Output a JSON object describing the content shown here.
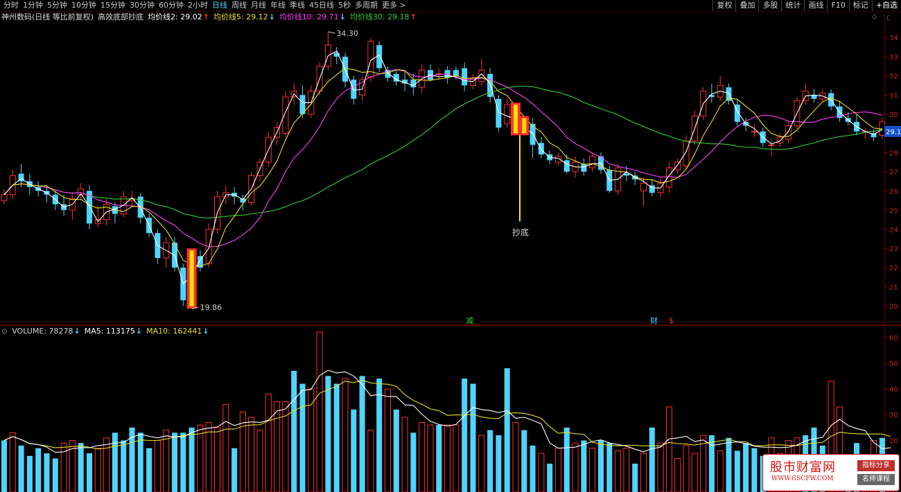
{
  "toolbar": {
    "tabs": [
      "分时",
      "1分钟",
      "5分钟",
      "10分钟",
      "15分钟",
      "30分钟",
      "60分钟",
      "2小时",
      "日线",
      "周线",
      "月线",
      "年线",
      "季线",
      "45日线",
      "5秒",
      "多周期",
      "更多 >"
    ],
    "active_tab": "日线",
    "right_tools": [
      "复权",
      "叠加",
      "多股",
      "统计",
      "画线",
      "F10",
      "标记"
    ],
    "select_label": "+自选"
  },
  "price_legend": {
    "title": "神州数码(日线 等比前复权)",
    "indicator": "高效底部抄底",
    "ma2": "均价线2: 29.02",
    "ma2_dir": "↑",
    "ma5": "均价线5: 29.12",
    "ma5_dir": "↓",
    "ma10": "均价线10: 29.71",
    "ma10_dir": "↓",
    "ma30": "均价线30: 29.18",
    "ma30_dir": "↑"
  },
  "volume_legend": {
    "volume": "VOLUME: 78278",
    "volume_dir": "↓",
    "ma5": "MA5: 113175",
    "ma5_dir": "↓",
    "ma10": "MA10: 162441",
    "ma10_dir": "↓"
  },
  "colors": {
    "up": "#ff3030",
    "down": "#4fd4ff",
    "ma2": "#ffffff",
    "ma5": "#e8e020",
    "ma10": "#ff40ff",
    "ma30": "#30d030",
    "signal": "#ffe000"
  },
  "watermark": {
    "title": "股市财富网",
    "url": "WWW.GSCFW.COM",
    "badge1": "指标分享",
    "badge2": "名师课程"
  },
  "chart_data": [
    {
      "type": "candlestick",
      "y_axis_labels": [
        "34",
        "33",
        "32",
        "31",
        "30",
        "29",
        "28",
        "27",
        "26",
        "25",
        "24",
        "23",
        "22",
        "21",
        "20"
      ],
      "current_price": "29.1",
      "annotations": {
        "high_label": "34.30",
        "low_label": "19.86",
        "signal_label": "抄底"
      },
      "event_markers": [
        {
          "label": "减",
          "color": "#30d030"
        },
        {
          "label": "财",
          "color": "#4fd4ff"
        },
        {
          "label": "$",
          "color": "#ff3030"
        }
      ],
      "ylim": [
        19.5,
        34.8
      ],
      "candles": [
        [
          25.5,
          25.8,
          26.1,
          25.3
        ],
        [
          25.8,
          26.8,
          27.1,
          25.6
        ],
        [
          26.9,
          26.5,
          27.4,
          26.2
        ],
        [
          26.5,
          26.2,
          26.9,
          25.8
        ],
        [
          26.2,
          26.0,
          26.5,
          25.7
        ],
        [
          26.0,
          25.8,
          26.3,
          25.4
        ],
        [
          25.8,
          25.3,
          26.0,
          25.0
        ],
        [
          25.3,
          25.0,
          25.8,
          24.7
        ],
        [
          25.0,
          25.6,
          25.9,
          24.5
        ],
        [
          25.8,
          26.1,
          26.4,
          25.5
        ],
        [
          26.0,
          24.3,
          26.3,
          24.0
        ],
        [
          24.3,
          24.5,
          25.2,
          24.1
        ],
        [
          24.5,
          25.3,
          25.6,
          24.2
        ],
        [
          25.2,
          24.8,
          25.4,
          24.3
        ],
        [
          24.8,
          25.7,
          26.0,
          24.6
        ],
        [
          25.5,
          25.6,
          26.0,
          25.2
        ],
        [
          25.7,
          24.6,
          25.9,
          24.3
        ],
        [
          24.6,
          23.8,
          24.8,
          23.6
        ],
        [
          23.8,
          22.5,
          24.0,
          22.2
        ],
        [
          22.5,
          23.3,
          23.6,
          22.0
        ],
        [
          23.3,
          22.0,
          23.6,
          21.8
        ],
        [
          22.0,
          20.3,
          22.2,
          20.0
        ],
        [
          20.3,
          22.8,
          23.0,
          19.86
        ],
        [
          22.6,
          22.0,
          22.9,
          21.8
        ],
        [
          22.2,
          24.0,
          24.3,
          22.0
        ],
        [
          24.0,
          25.7,
          26.0,
          23.8
        ],
        [
          25.7,
          25.9,
          26.3,
          25.3
        ],
        [
          25.9,
          25.7,
          26.2,
          25.3
        ],
        [
          25.6,
          25.4,
          25.8,
          25.0
        ],
        [
          25.4,
          26.8,
          27.0,
          25.2
        ],
        [
          26.8,
          27.5,
          27.7,
          26.5
        ],
        [
          27.5,
          28.8,
          29.1,
          27.3
        ],
        [
          28.8,
          29.3,
          29.6,
          28.4
        ],
        [
          29.0,
          30.9,
          31.2,
          28.8
        ],
        [
          30.9,
          31.2,
          31.6,
          30.5
        ],
        [
          31.0,
          30.0,
          31.5,
          29.8
        ],
        [
          30.0,
          31.2,
          31.5,
          29.8
        ],
        [
          31.2,
          32.5,
          32.7,
          31.0
        ],
        [
          32.5,
          33.6,
          34.3,
          32.3
        ],
        [
          33.2,
          33.0,
          33.5,
          32.6
        ],
        [
          33.0,
          31.7,
          33.2,
          31.4
        ],
        [
          31.8,
          30.8,
          32.0,
          30.5
        ],
        [
          31.0,
          31.8,
          32.0,
          30.7
        ],
        [
          31.9,
          33.8,
          34.0,
          31.7
        ],
        [
          33.6,
          32.4,
          33.8,
          32.2
        ],
        [
          32.3,
          31.9,
          32.5,
          31.7
        ],
        [
          32.1,
          31.7,
          32.3,
          31.5
        ],
        [
          31.8,
          31.6,
          32.2,
          31.2
        ],
        [
          31.8,
          31.4,
          32.1,
          31.0
        ],
        [
          31.4,
          32.3,
          32.6,
          31.1
        ],
        [
          32.3,
          31.8,
          32.6,
          31.7
        ],
        [
          32.1,
          32.1,
          32.4,
          31.8
        ],
        [
          32.3,
          31.9,
          32.5,
          31.6
        ],
        [
          32.3,
          32.0,
          32.5,
          31.8
        ],
        [
          32.4,
          31.5,
          32.7,
          31.2
        ],
        [
          31.5,
          31.9,
          32.1,
          31.3
        ],
        [
          31.7,
          32.3,
          32.9,
          31.5
        ],
        [
          32.1,
          30.9,
          32.4,
          30.6
        ],
        [
          30.8,
          29.3,
          31.0,
          29.1
        ],
        [
          29.5,
          30.5,
          30.8,
          29.3
        ],
        [
          30.4,
          29.0,
          30.6,
          28.9
        ],
        [
          29.1,
          29.6,
          29.9,
          28.9
        ],
        [
          29.5,
          28.4,
          29.8,
          27.7
        ],
        [
          28.5,
          27.9,
          28.8,
          27.7
        ],
        [
          27.9,
          27.6,
          28.1,
          27.4
        ],
        [
          27.5,
          27.8,
          28.0,
          27.3
        ],
        [
          27.6,
          27.0,
          27.9,
          26.9
        ],
        [
          27.0,
          27.5,
          27.8,
          26.7
        ],
        [
          27.4,
          27.0,
          27.7,
          26.8
        ],
        [
          27.2,
          27.8,
          28.0,
          27.0
        ],
        [
          27.8,
          27.1,
          28.0,
          26.9
        ],
        [
          27.1,
          26.0,
          27.3,
          25.9
        ],
        [
          26.0,
          27.2,
          27.4,
          25.8
        ],
        [
          26.9,
          26.8,
          27.3,
          26.5
        ],
        [
          26.8,
          26.6,
          27.0,
          26.3
        ],
        [
          26.0,
          26.4,
          26.7,
          25.2
        ],
        [
          26.3,
          25.9,
          26.6,
          25.7
        ],
        [
          25.9,
          26.4,
          26.7,
          25.7
        ],
        [
          26.2,
          27.2,
          27.5,
          25.9
        ],
        [
          27.1,
          27.5,
          27.7,
          26.9
        ],
        [
          27.3,
          28.6,
          28.9,
          27.1
        ],
        [
          28.6,
          29.9,
          30.2,
          28.4
        ],
        [
          29.9,
          31.2,
          31.4,
          29.7
        ],
        [
          31.0,
          30.9,
          31.6,
          30.6
        ],
        [
          30.9,
          31.5,
          32.0,
          30.7
        ],
        [
          31.4,
          30.7,
          31.6,
          30.5
        ],
        [
          30.5,
          29.6,
          30.8,
          29.4
        ],
        [
          29.6,
          29.4,
          29.8,
          29.1
        ],
        [
          29.1,
          29.1,
          29.5,
          28.8
        ],
        [
          29.1,
          28.5,
          29.3,
          28.3
        ],
        [
          28.4,
          28.4,
          28.7,
          27.8
        ],
        [
          28.5,
          28.8,
          29.0,
          28.3
        ],
        [
          28.7,
          29.4,
          29.6,
          28.5
        ],
        [
          29.4,
          30.7,
          30.9,
          29.2
        ],
        [
          30.7,
          31.2,
          31.6,
          30.5
        ],
        [
          31.0,
          30.8,
          31.3,
          30.6
        ],
        [
          30.8,
          31.1,
          31.3,
          30.6
        ],
        [
          31.1,
          30.4,
          31.3,
          30.2
        ],
        [
          30.4,
          29.8,
          30.7,
          29.6
        ],
        [
          29.8,
          29.6,
          30.1,
          29.4
        ],
        [
          29.6,
          29.1,
          30.0,
          28.9
        ],
        [
          29.1,
          29.1,
          29.3,
          28.7
        ],
        [
          29.0,
          28.8,
          29.2,
          28.6
        ],
        [
          28.9,
          29.6,
          29.8,
          28.7
        ]
      ],
      "signal_candles": [
        22,
        60,
        61
      ]
    },
    {
      "type": "bar",
      "y_axis_labels": [
        "60",
        "50",
        "40",
        "30",
        "20"
      ],
      "ylim": [
        0,
        62
      ],
      "volumes": [
        20,
        23,
        18,
        14,
        17,
        15,
        13,
        19,
        20,
        19,
        15,
        17,
        21,
        23,
        20,
        25,
        23,
        17,
        20,
        24,
        23,
        23,
        25,
        26,
        27,
        25,
        34,
        17,
        31,
        29,
        24,
        38,
        35,
        35,
        47,
        42,
        40,
        62,
        45,
        42,
        44,
        32,
        45,
        24,
        44,
        40,
        32,
        29,
        23,
        27,
        26,
        26,
        26,
        26,
        44,
        42,
        22,
        24,
        22,
        48,
        27,
        24,
        18,
        15,
        11,
        17,
        25,
        19,
        20,
        17,
        20,
        19,
        16,
        17,
        11,
        15,
        25,
        19,
        33,
        13,
        18,
        15,
        22,
        22,
        16,
        21,
        16,
        19,
        17,
        14,
        21,
        15,
        20,
        21,
        22,
        25,
        18,
        43,
        33,
        10,
        19,
        14,
        20,
        21,
        12
      ],
      "vol_up": [
        false,
        true,
        false,
        false,
        false,
        false,
        false,
        true,
        true,
        false,
        false,
        true,
        true,
        false,
        false,
        false,
        false,
        false,
        true,
        true,
        false,
        false,
        false,
        true,
        true,
        true,
        true,
        false,
        true,
        true,
        true,
        true,
        true,
        true,
        false,
        false,
        true,
        true,
        false,
        false,
        true,
        false,
        false,
        true,
        false,
        true,
        false,
        true,
        false,
        true,
        true,
        false,
        true,
        true,
        false,
        false,
        true,
        false,
        false,
        false,
        true,
        false,
        false,
        true,
        false,
        true,
        false,
        true,
        false,
        true,
        false,
        false,
        true,
        true,
        false,
        true,
        false,
        true,
        true,
        true,
        true,
        true,
        true,
        false,
        true,
        false,
        false,
        false,
        false,
        false,
        true,
        true,
        true,
        true,
        false,
        false,
        false,
        true,
        true,
        false,
        false,
        true,
        true,
        false,
        true
      ]
    }
  ]
}
